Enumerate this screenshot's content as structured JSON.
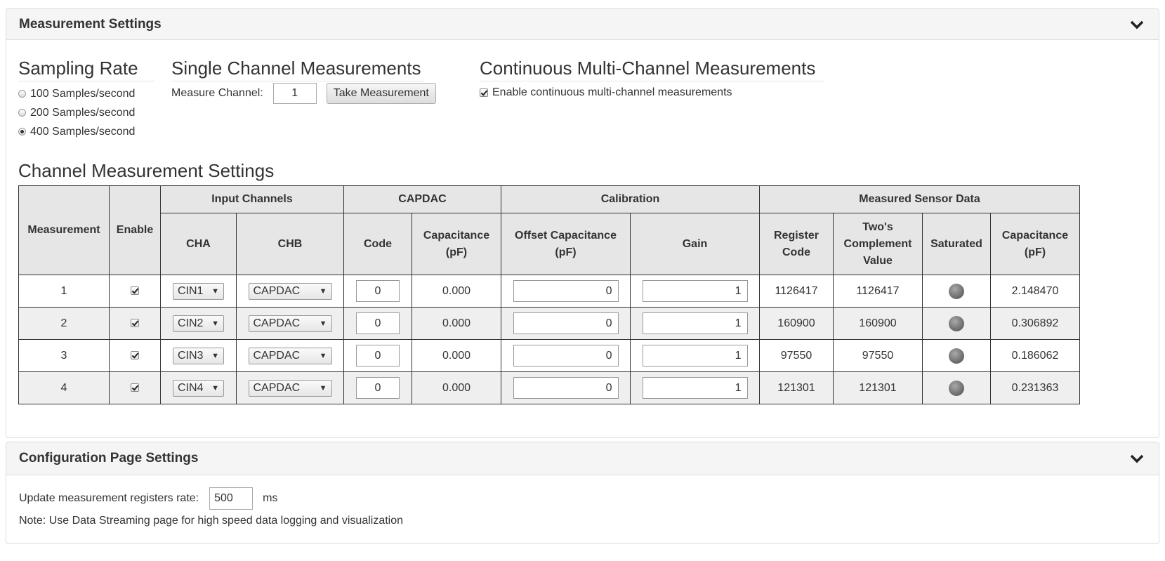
{
  "measurement_panel": {
    "title": "Measurement Settings",
    "sampling_rate": {
      "heading": "Sampling Rate",
      "options": [
        {
          "label": "100 Samples/second",
          "selected": false
        },
        {
          "label": "200 Samples/second",
          "selected": false
        },
        {
          "label": "400 Samples/second",
          "selected": true
        }
      ]
    },
    "single_channel": {
      "heading": "Single Channel Measurements",
      "channel_label": "Measure Channel:",
      "channel_value": "1",
      "button_label": "Take Measurement"
    },
    "continuous": {
      "heading": "Continuous Multi-Channel Measurements",
      "checkbox_label": "Enable continuous multi-channel measurements",
      "checked": true
    },
    "channel_settings": {
      "heading": "Channel Measurement Settings",
      "headers": {
        "measurement": "Measurement",
        "enable": "Enable",
        "input_channels": "Input Channels",
        "capdac": "CAPDAC",
        "calibration": "Calibration",
        "measured": "Measured Sensor Data",
        "cha": "CHA",
        "chb": "CHB",
        "code": "Code",
        "capdac_capacitance": "Capacitance (pF)",
        "offset": "Offset Capacitance (pF)",
        "gain": "Gain",
        "register_code": "Register Code",
        "twos_complement": "Two's Complement Value",
        "saturated": "Saturated",
        "capacitance": "Capacitance (pF)"
      },
      "rows": [
        {
          "measurement": "1",
          "enabled": true,
          "cha": "CIN1",
          "chb": "CAPDAC",
          "code": "0",
          "capdac_cap": "0.000",
          "offset": "0",
          "gain": "1",
          "register_code": "1126417",
          "twos": "1126417",
          "capacitance": "2.148470"
        },
        {
          "measurement": "2",
          "enabled": true,
          "cha": "CIN2",
          "chb": "CAPDAC",
          "code": "0",
          "capdac_cap": "0.000",
          "offset": "0",
          "gain": "1",
          "register_code": "160900",
          "twos": "160900",
          "capacitance": "0.306892"
        },
        {
          "measurement": "3",
          "enabled": true,
          "cha": "CIN3",
          "chb": "CAPDAC",
          "code": "0",
          "capdac_cap": "0.000",
          "offset": "0",
          "gain": "1",
          "register_code": "97550",
          "twos": "97550",
          "capacitance": "0.186062"
        },
        {
          "measurement": "4",
          "enabled": true,
          "cha": "CIN4",
          "chb": "CAPDAC",
          "code": "0",
          "capdac_cap": "0.000",
          "offset": "0",
          "gain": "1",
          "register_code": "121301",
          "twos": "121301",
          "capacitance": "0.231363"
        }
      ]
    }
  },
  "config_panel": {
    "title": "Configuration Page Settings",
    "rate_label": "Update measurement registers rate:",
    "rate_value": "500",
    "rate_unit": "ms",
    "note": "Note: Use Data Streaming page for high speed data logging and visualization"
  },
  "icons": {
    "collapse": "chevron-down-icon",
    "saturation_led": "led-indicator-icon",
    "dropdown": "triangle-down-icon"
  }
}
